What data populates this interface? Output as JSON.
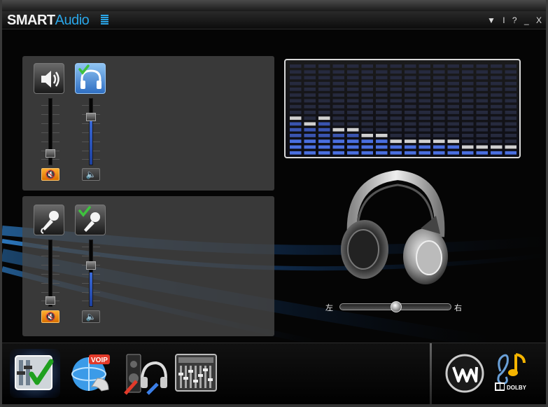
{
  "app": {
    "brand_smart": "SMART",
    "brand_audio": "Audio",
    "controls": {
      "menu": "▼",
      "info": "I",
      "help": "?",
      "minimize": "_",
      "close": "X"
    }
  },
  "playback": {
    "speaker": {
      "icon": "speaker-icon",
      "level": 0.18,
      "muted": true
    },
    "headphone": {
      "icon": "headphone-icon",
      "level": 0.72,
      "muted": false,
      "selected": true
    }
  },
  "recording": {
    "mic1": {
      "icon": "microphone-icon",
      "level": 0.18,
      "muted": true
    },
    "mic2": {
      "icon": "microphone-icon",
      "level": 0.72,
      "muted": false,
      "selected": true
    }
  },
  "equalizer": {
    "bands": 16,
    "peak_rows": [
      9,
      10,
      9,
      11,
      11,
      12,
      12,
      13,
      13,
      13,
      13,
      13,
      14,
      14,
      14,
      14
    ]
  },
  "balance": {
    "left_label": "左",
    "right_label": "右",
    "value": 0.5
  },
  "bottom_nav": [
    {
      "icon": "mixer-check-icon",
      "selected": true
    },
    {
      "icon": "voip-globe-icon",
      "selected": false
    },
    {
      "icon": "speakers-headphones-icon",
      "selected": false
    },
    {
      "icon": "equalizer-panel-icon",
      "selected": false
    },
    {
      "icon": "waves-logo-icon",
      "selected": false
    },
    {
      "icon": "dolby-music-icon",
      "selected": false
    }
  ],
  "colors": {
    "accent": "#2aa6e8",
    "mute_on": "#f08c0c",
    "eq_lit": "#4a6fe0",
    "eq_dim": "#262a3e"
  }
}
